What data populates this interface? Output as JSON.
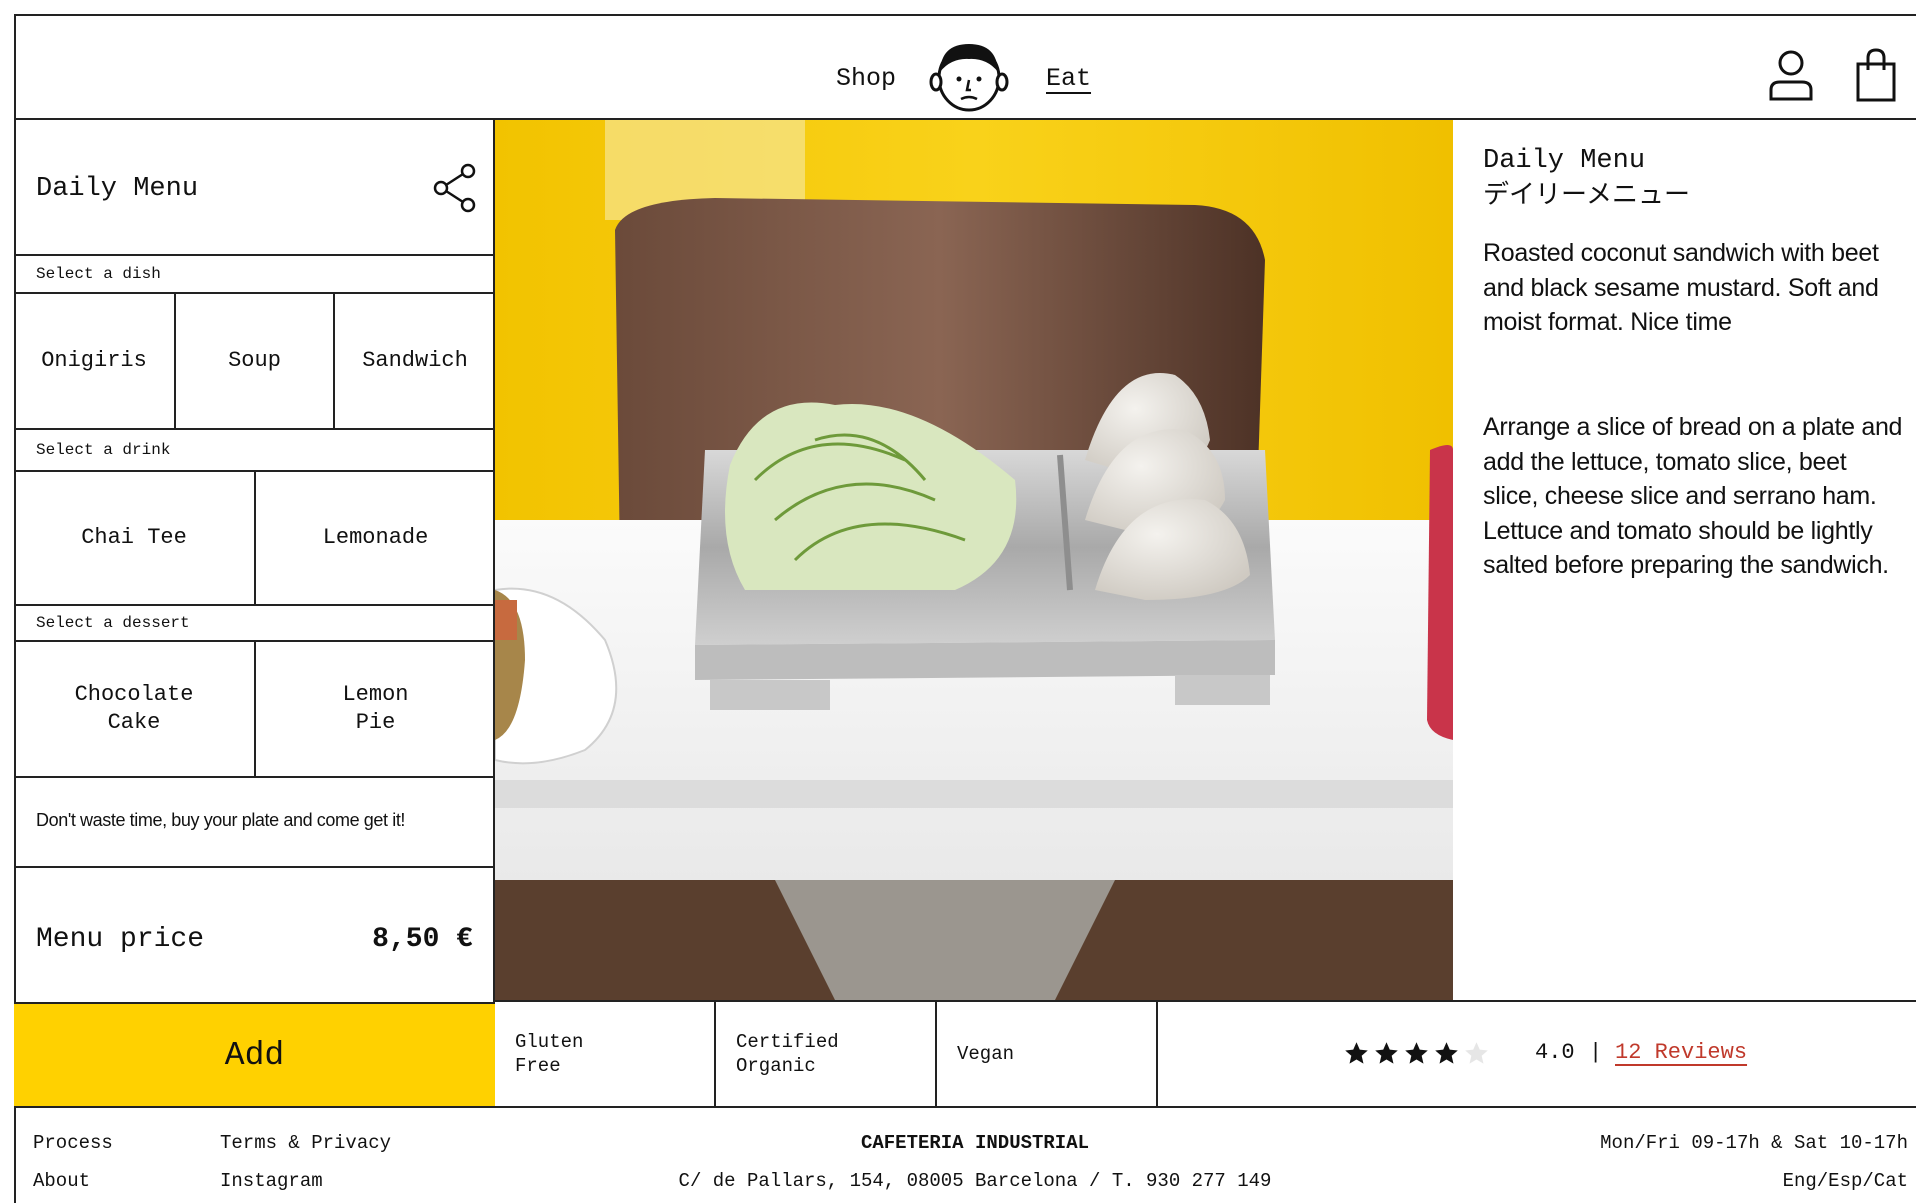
{
  "header": {
    "nav_shop": "Shop",
    "nav_eat": "Eat",
    "logo_icon": "face-mascot-icon",
    "user_icon": "user-icon",
    "bag_icon": "shopping-bag-icon"
  },
  "menu": {
    "title": "Daily Menu",
    "share_icon": "share-icon",
    "dish_label": "Select a dish",
    "dishes": [
      "Onigiris",
      "Soup",
      "Sandwich"
    ],
    "drink_label": "Select a drink",
    "drinks": [
      "Chai Tee",
      "Lemonade"
    ],
    "dessert_label": "Select a dessert",
    "desserts": [
      "Chocolate\nCake",
      "Lemon\nPie"
    ],
    "promo": "Don't waste time, buy your plate and come get it!",
    "price_label": "Menu price",
    "price_value": "8,50 €",
    "add_label": "Add"
  },
  "description": {
    "title": "Daily Menu",
    "title_jp": "デイリーメニュー",
    "paragraph1": "Roasted coconut sandwich with beet and black sesame mustard. Soft and moist format. Nice time",
    "paragraph2": "Arrange a slice of bread on a plate and add the lettuce, tomato slice, beet slice, cheese slice and serrano ham. Lettuce and tomato should be lightly salted before preparing the sandwich."
  },
  "tags": [
    "Gluten\nFree",
    "Certified\nOrganic",
    "Vegan"
  ],
  "rating": {
    "stars": 4,
    "max_stars": 5,
    "value": "4.0",
    "separator": "|",
    "reviews_label": "12 Reviews",
    "star_color": "#111111",
    "empty_star_color": "#e6e6e6",
    "link_color": "#c0392b"
  },
  "footer": {
    "process": "Process",
    "about": "About",
    "terms": "Terms & Privacy",
    "instagram": "Instagram",
    "brand": "CAFETERIA INDUSTRIAL",
    "address": "C/ de Pallars, 154, 08005 Barcelona / T. 930 277 149",
    "hours": "Mon/Fri 09-17h & Sat 10-17h",
    "languages": "Eng/Esp/Cat"
  },
  "colors": {
    "accent": "#ffd100",
    "border": "#222222"
  }
}
